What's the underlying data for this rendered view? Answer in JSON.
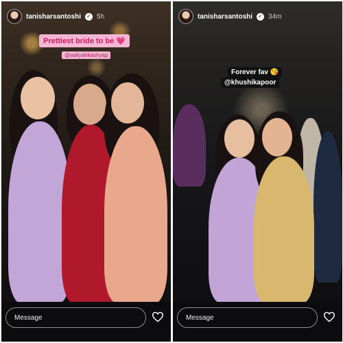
{
  "stories": [
    {
      "username": "tanisharsantoshi",
      "verified_icon": "verified-badge-icon",
      "time": "5h",
      "sticker_text": "Prettiest bride to be",
      "sticker_emoji": "💗",
      "mention": "@aaliyahkashyap",
      "message_placeholder": "Message",
      "like_icon": "heart-outline-icon"
    },
    {
      "username": "tanisharsantoshi",
      "verified_icon": "verified-badge-icon",
      "time": "34m",
      "sticker_line1": "Forever fav",
      "sticker_emoji": "😘",
      "mention": "@khushikapoor",
      "message_placeholder": "Message",
      "like_icon": "heart-outline-icon"
    }
  ],
  "colors": {
    "background": "#0c0c0e",
    "sticker_pink": "#f3b6d3",
    "sticker_text": "#d01b63"
  }
}
